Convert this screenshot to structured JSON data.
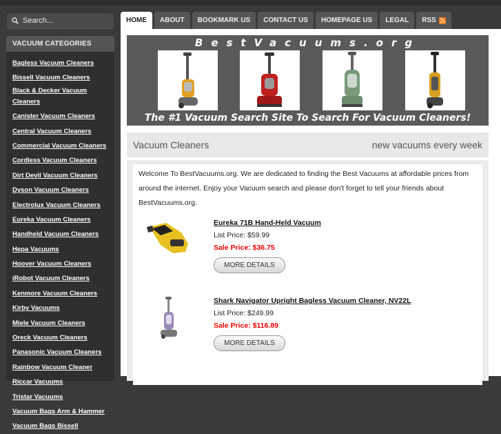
{
  "search": {
    "placeholder": "Search..."
  },
  "sidebar": {
    "heading": "VACUUM CATEGORIES",
    "items": [
      "Bagless Vacuum Cleaners",
      "Bissell Vacuum Cleaners",
      "Black & Decker Vacuum Cleaners",
      "Canister Vacuum Cleaners",
      "Central Vacuum Cleaners",
      "Commercial Vacuum Cleaners",
      "Cordless Vacuum Cleaners",
      "Dirt Devil Vacuum Cleaners",
      "Dyson Vacuum Cleaners",
      "Electrolux Vacuum Cleaners",
      "Eureka Vacuum Cleaners",
      "Handheld Vacuum Cleaners",
      "Hepa Vacuums",
      "Hoover Vacuum Cleaners",
      "iRobot Vacuum Cleaners",
      "Kenmore Vacuum Cleaners",
      "Kirby Vacuums",
      "Miele Vacuum Cleaners",
      "Oreck Vacuum Cleaners",
      "Panasonic Vacuum Cleaners",
      "Rainbow Vacuum Cleaner",
      "Riccar Vacuums",
      "Tristar Vacuums",
      "Vacuum Bags Arm & Hammer",
      "Vacuum Bags Bissell"
    ]
  },
  "tabs": [
    "HOME",
    "ABOUT",
    "BOOKMARK US",
    "CONTACT US",
    "HOMEPAGE US",
    "LEGAL",
    "RSS"
  ],
  "banner": {
    "title": "BestVacuums.org",
    "tagline": "The #1 Vacuum Search Site To Search For Vacuum Cleaners!"
  },
  "strip": {
    "left": "Vacuum Cleaners",
    "right": "new vacuums every week"
  },
  "intro": "Welcome To BestVacuums.org. We are dedicated to finding the Best Vacuums at affordable prices from around the internet. Enjoy your Vacuum search and please don't forget to tell your friends about BestVacuums.org.",
  "products": [
    {
      "name": "Eureka 71B Hand-Held Vacuum",
      "list_price": "List Price: $59.99",
      "sale_price": "Sale Price: $36.75",
      "button": "MORE DETAILS"
    },
    {
      "name": "Shark Navigator Upright Bagless Vacuum Cleaner, NV22L",
      "list_price": "List Price: $249.99",
      "sale_price": "Sale Price: $116.89",
      "button": "MORE DETAILS"
    }
  ],
  "colors": {
    "sale": "#e00000",
    "sidebar_bg": "#2f2f2f",
    "banner_bg": "#5a5a5a",
    "rss": "#f58220"
  }
}
